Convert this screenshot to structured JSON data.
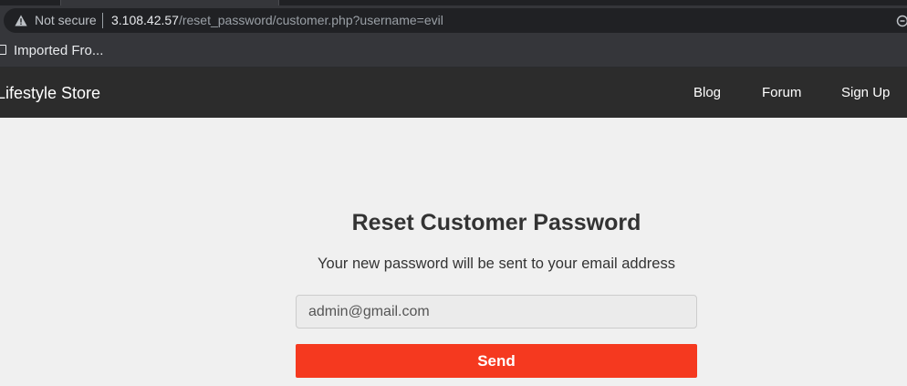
{
  "browser": {
    "security_label": "Not secure",
    "url_host": "3.108.42.57",
    "url_path": "/reset_password/customer.php?username=evil",
    "bookmark_label": "Imported Fro..."
  },
  "navbar": {
    "brand": "Lifestyle Store",
    "items": [
      {
        "label": "Blog"
      },
      {
        "label": "Forum"
      },
      {
        "label": "Sign Up"
      }
    ]
  },
  "reset_form": {
    "title": "Reset Customer Password",
    "subtitle": "Your new password will be sent to your email address",
    "email_value": "admin@gmail.com",
    "send_label": "Send"
  },
  "colors": {
    "navbar_bg": "#2c2c2c",
    "accent": "#f5391f",
    "page_bg": "#f0f0f0"
  },
  "icons": {
    "security": "warning-triangle-icon",
    "bookmark": "folder-icon",
    "omnibox_end": "zoom-icon"
  }
}
